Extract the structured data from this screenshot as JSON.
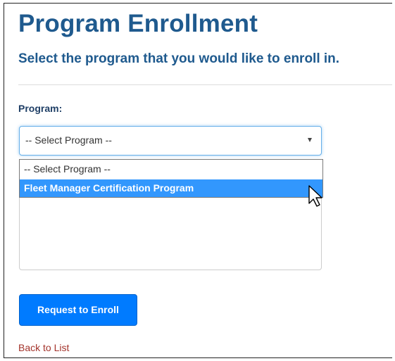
{
  "page": {
    "title": "Program Enrollment",
    "subtitle": "Select the program that you would like to enroll in."
  },
  "form": {
    "program_label": "Program:",
    "program_select": {
      "selected_value": "-- Select Program --",
      "options": [
        "-- Select Program --",
        "Fleet Manager Certification Program"
      ],
      "highlighted_option": "Fleet Manager Certification Program",
      "open": true
    },
    "comments_value": ""
  },
  "actions": {
    "enroll_button_label": "Request to Enroll",
    "back_link_label": "Back to List"
  },
  "colors": {
    "heading": "#1f5a8e",
    "primary_button": "#007bff",
    "highlight": "#3297fd",
    "link": "#a3332b"
  }
}
